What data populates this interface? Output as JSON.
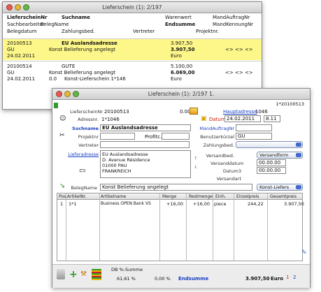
{
  "back_window": {
    "title": "Lieferschein (1): 2/197",
    "headers": {
      "row1": {
        "col1": "LieferscheinNr",
        "col2": "Suchname",
        "col3": "Warenwert",
        "col4": "MandAuftragNr"
      },
      "row2": {
        "col1": "Sachbearbeiter",
        "col2": "BelegName",
        "col3": "Endsumme",
        "col4": "MandKennungNr"
      },
      "row3": {
        "col1": "Belegdatum",
        "col2": "Zahlungsbed.",
        "col3": "Vertreter",
        "col4": "Projektnr."
      }
    },
    "records": [
      {
        "nr": "20100513",
        "user": "GU",
        "date": "24.02.2011",
        "suchname": "EU Auslandsadresse",
        "belegname": "Konst Belieferung angelegt",
        "zahlung": "",
        "warenwert": "3.907,50",
        "endsumme": "3.907,50",
        "vertreter": "Euro",
        "extra": "<> <> <>",
        "highlight": true
      },
      {
        "nr": "20100514",
        "user": "GU",
        "date": "24.02.2011",
        "suchname": "GUTE",
        "belegname": "Konst Belieferung angelegt",
        "zahlung": "0.0",
        "warenwert": "5.100,00",
        "endsumme": "6.069,00",
        "vertreter": "Euro",
        "extra": "<> <> <>",
        "col_a": "0.0",
        "konst": "Konst-Lieferschein 1*146",
        "highlight": false
      }
    ]
  },
  "front_window": {
    "title": "Lieferschein (1): 2/197 1.",
    "record_id": "1*20100513",
    "lieferschein_label": "LieferscheinNr",
    "lieferschein_nr": "20100513",
    "currency_code": "0.00",
    "currency_val": "0.00",
    "hauptadresse_label": "Hauptadresse",
    "hauptadresse_nr": "1046",
    "adressnr_label": "Adressnr.",
    "adressnr": "1*1046",
    "datum_label": "Datum",
    "datum": "24.02.2011",
    "kw": "8.11",
    "suchname_label": "Suchname",
    "suchname": "EU Auslandsadresse",
    "mandauftrag_label": "MandAuftragNr",
    "mandauftrag": "",
    "projektnr_label": "Projektnr",
    "projekt_label": "Profitc.",
    "benutzer_label": "Benutzerkürzel",
    "benutzer": "GU",
    "vertreter_label": "Vertreter",
    "zahlungsbed_label": "Zahlungsbed.",
    "lieferadresse_label": "Lieferadresse",
    "lieferadresse": [
      "EU Auslandsadresse",
      "D. Avenue Résidence",
      "01000 PAU",
      "FRANKREICH"
    ],
    "versandbed_label": "Versandbed.",
    "versandbed": "Versandform",
    "versanddatum_label": "Versanddatum",
    "versanddatum": "00.00.00",
    "datum3_label": "Datum3",
    "datum3": "00.00.00",
    "versandart_label": "Versandart",
    "belegname_label": "BelegName",
    "belegname": "Konst Belieferung angelegt",
    "konst_select": "Konst-Liefers",
    "grid": {
      "headers": [
        "Pos.",
        "ArtikelNr.",
        "Artikelname",
        "Menge",
        "Restmenge",
        "Einh.",
        "Einzelpreis",
        "Gesamtpreis"
      ],
      "rows": [
        {
          "pos": "1",
          "artikelnr": "1*1",
          "name": "Business OPEN Bank VS",
          "menge": "+16,00",
          "rest": "+16,00",
          "einh": "piece",
          "einzel": "244,22",
          "gesamt": "3.907,50"
        }
      ]
    },
    "footer": {
      "dk_label": "DB %-Summe",
      "dk_value": "0,00 %",
      "pct_value": "61,61 %",
      "endsumme_label": "Endsumme",
      "endsumme": "3.907,50",
      "currency": "Euro",
      "page_a": "1",
      "page_b": "2"
    }
  }
}
